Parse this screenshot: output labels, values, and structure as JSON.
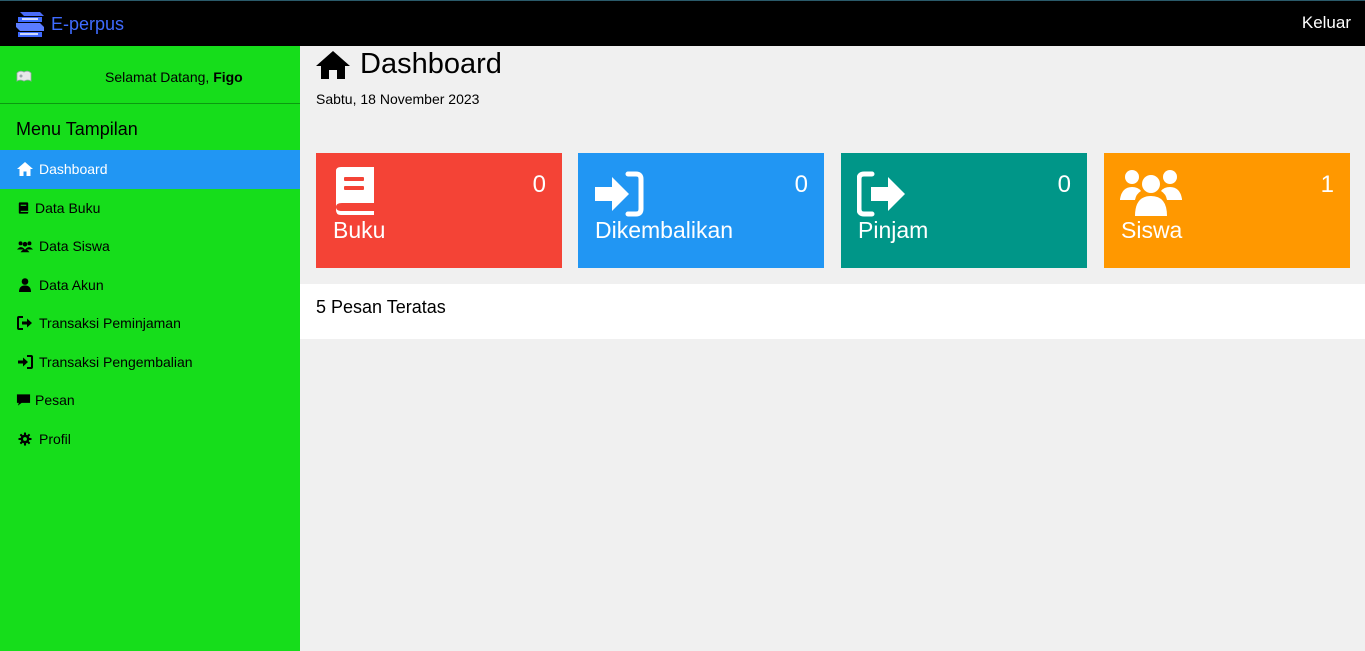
{
  "topbar": {
    "brand": "E-perpus",
    "logout_label": "Keluar",
    "brand_icon": "book-stack-icon"
  },
  "sidebar": {
    "welcome_prefix": "Selamat Datang,",
    "user_name": "Figo",
    "menu_heading": "Menu Tampilan",
    "items": [
      {
        "label": "Dashboard",
        "icon": "home-icon",
        "active": true
      },
      {
        "label": "Data Buku",
        "icon": "book-icon"
      },
      {
        "label": "Data Siswa",
        "icon": "users-icon"
      },
      {
        "label": "Data Akun",
        "icon": "user-icon"
      },
      {
        "label": "Transaksi Peminjaman",
        "icon": "sign-out-icon"
      },
      {
        "label": "Transaksi Pengembalian",
        "icon": "sign-in-icon"
      },
      {
        "label": "Pesan",
        "icon": "comment-icon"
      },
      {
        "label": "Profil",
        "icon": "gear-icon"
      }
    ]
  },
  "main": {
    "title": "Dashboard",
    "date": "Sabtu, 18 November 2023",
    "cards": [
      {
        "label": "Buku",
        "count": "0",
        "color": "#f44336",
        "icon": "book-icon"
      },
      {
        "label": "Dikembalikan",
        "count": "0",
        "color": "#2196f3",
        "icon": "sign-in-icon"
      },
      {
        "label": "Pinjam",
        "count": "0",
        "color": "#009688",
        "icon": "sign-out-icon"
      },
      {
        "label": "Siswa",
        "count": "1",
        "color": "#ff9800",
        "icon": "users-icon"
      }
    ],
    "messages_title": "5 Pesan Teratas"
  },
  "colors": {
    "sidebar_bg": "#16dd1b",
    "active_item": "#2196f3",
    "brand_text": "#3f6bff"
  }
}
